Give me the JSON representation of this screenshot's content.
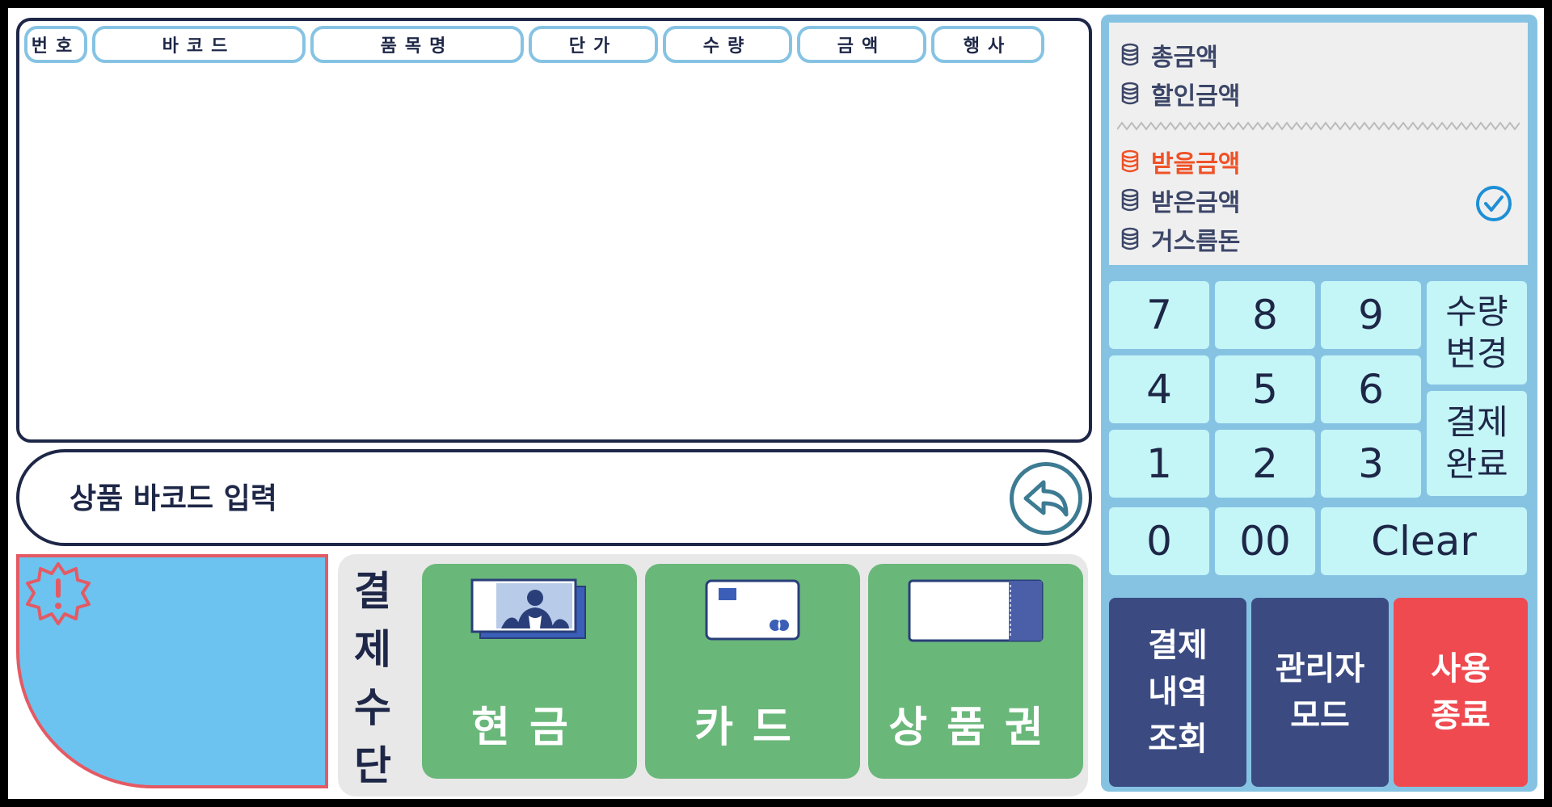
{
  "table": {
    "columns": [
      "번호",
      "바코드",
      "품목명",
      "단가",
      "수량",
      "금액",
      "행사"
    ],
    "rows": []
  },
  "barcode": {
    "placeholder": "상품 바코드 입력"
  },
  "payment": {
    "label_chars": [
      "결",
      "제",
      "수",
      "단"
    ],
    "methods": [
      {
        "label": "현금",
        "icon": "cash-icon"
      },
      {
        "label": "카드",
        "icon": "credit-card-icon"
      },
      {
        "label": "상품권",
        "icon": "gift-voucher-icon"
      }
    ]
  },
  "summary": {
    "total": "총금액",
    "discount": "할인금액",
    "to_receive": "받을금액",
    "received": "받은금액",
    "change": "거스름돈",
    "colors": {
      "normal": "#3c4668",
      "highlight": "#ef5227"
    }
  },
  "keypad": {
    "k7": "7",
    "k8": "8",
    "k9": "9",
    "k4": "4",
    "k5": "5",
    "k6": "6",
    "k1": "1",
    "k2": "2",
    "k3": "3",
    "k0": "0",
    "k00": "00",
    "clear": "Clear",
    "qty_change": [
      "수량",
      "변경"
    ],
    "pay_complete": [
      "결제",
      "완료"
    ]
  },
  "functions": {
    "history": [
      "결제",
      "내역",
      "조회"
    ],
    "admin": [
      "관리자",
      "모드"
    ],
    "exit": [
      "사용",
      "종료"
    ],
    "colors": {
      "navy": "#3b4b82",
      "red": "#ef4a50"
    }
  }
}
